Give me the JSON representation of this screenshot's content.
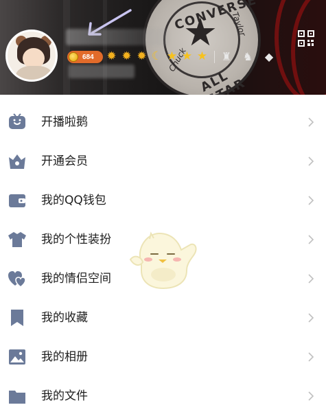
{
  "profile": {
    "coin_value": "684",
    "level_icons": [
      "sun",
      "sun",
      "sun",
      "moon",
      "star",
      "star",
      "star"
    ],
    "vip_icons": [
      "vip-hat-icon",
      "vip-character-icon",
      "vip-diamond-icon"
    ],
    "qr_icon": "qr-code-icon"
  },
  "menu": {
    "items": [
      {
        "label": "开播啦鹅",
        "icon": "tv-icon"
      },
      {
        "label": "开通会员",
        "icon": "crown-icon"
      },
      {
        "label": "我的QQ钱包",
        "icon": "wallet-icon"
      },
      {
        "label": "我的个性装扮",
        "icon": "shirt-icon"
      },
      {
        "label": "我的情侣空间",
        "icon": "couple-heart-icon"
      },
      {
        "label": "我的收藏",
        "icon": "bookmark-icon"
      },
      {
        "label": "我的相册",
        "icon": "photo-icon"
      },
      {
        "label": "我的文件",
        "icon": "folder-icon"
      }
    ]
  },
  "colors": {
    "icon_color": "#6b7a99",
    "text_color": "#1e1e1e",
    "chevron_color": "#c0c0c0",
    "coin_badge": "#e26b2a"
  }
}
